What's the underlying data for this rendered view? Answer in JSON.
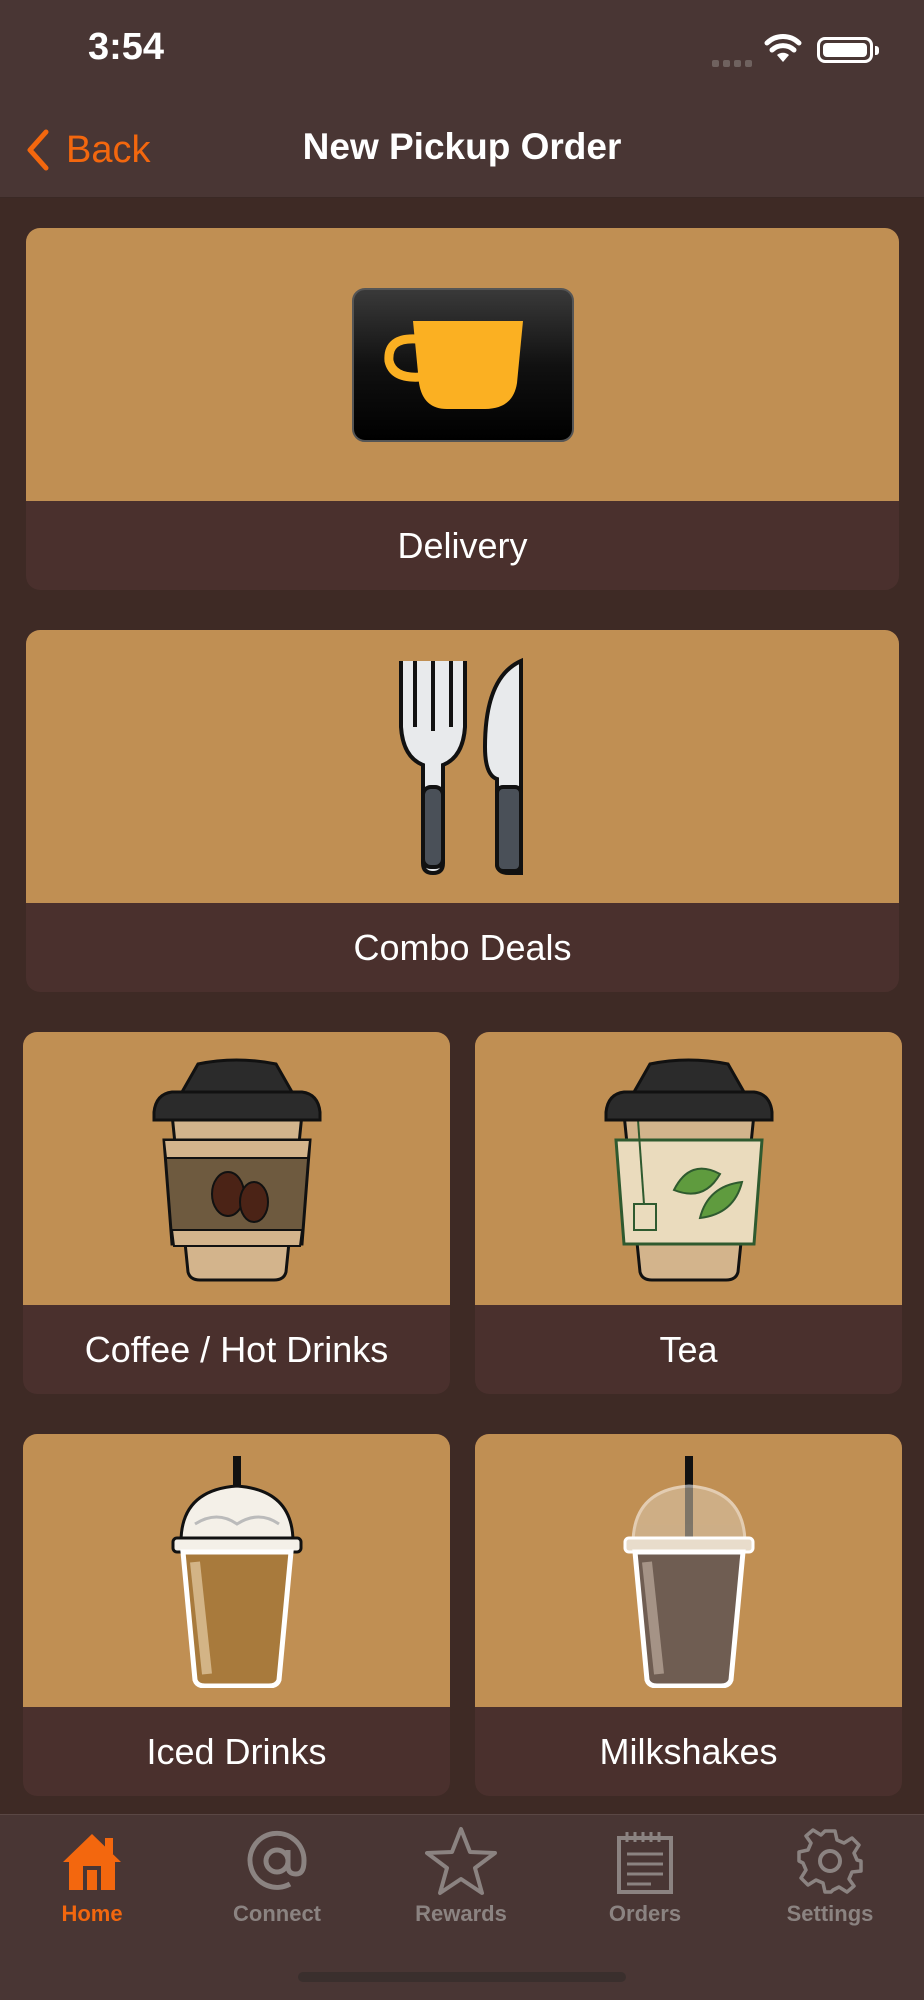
{
  "status_bar": {
    "time": "3:54"
  },
  "nav": {
    "back_label": "Back",
    "title": "New Pickup Order"
  },
  "tiles": [
    {
      "label": "Delivery",
      "icon": "coffee-cup-card-icon"
    },
    {
      "label": "Combo Deals",
      "icon": "fork-knife-icon"
    },
    {
      "label": "Coffee / Hot Drinks",
      "icon": "coffee-cup-icon"
    },
    {
      "label": "Tea",
      "icon": "tea-cup-icon"
    },
    {
      "label": "Iced Drinks",
      "icon": "iced-drink-icon"
    },
    {
      "label": "Milkshakes",
      "icon": "milkshake-icon"
    }
  ],
  "tab_bar": {
    "tabs": [
      {
        "label": "Home",
        "icon": "home-icon",
        "active": true
      },
      {
        "label": "Connect",
        "icon": "at-sign-icon",
        "active": false
      },
      {
        "label": "Rewards",
        "icon": "star-icon",
        "active": false
      },
      {
        "label": "Orders",
        "icon": "notepad-icon",
        "active": false
      },
      {
        "label": "Settings",
        "icon": "gear-icon",
        "active": false
      }
    ]
  },
  "colors": {
    "accent": "#f3670e",
    "tile_image_bg": "#c08f53",
    "tile_label_bg": "#4a302d",
    "background": "#3e2a25"
  }
}
